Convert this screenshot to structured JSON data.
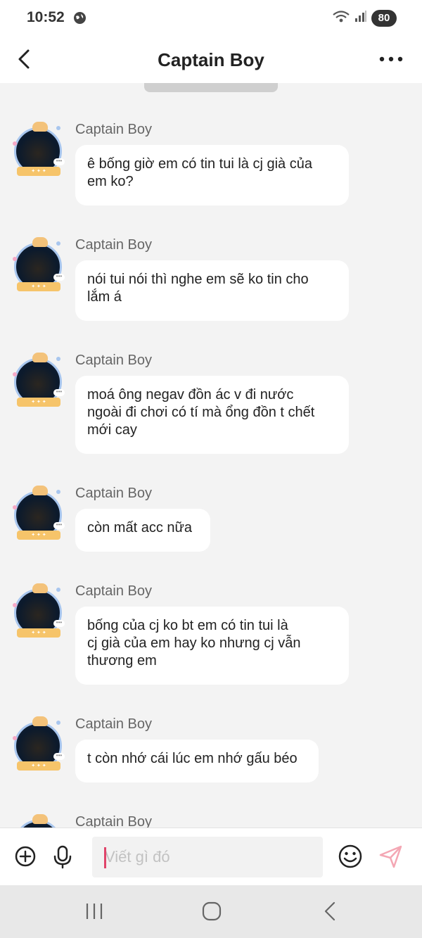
{
  "status_bar": {
    "time": "10:52",
    "battery": "80",
    "icons": [
      "globe-icon",
      "wifi-icon",
      "signal-icon",
      "battery-icon"
    ]
  },
  "header": {
    "title": "Captain Boy",
    "icons": [
      "back-arrow-icon",
      "more-dots-icon"
    ]
  },
  "messages": [
    {
      "sender": "Captain Boy",
      "text": "ê bống giờ em có tin tui là cj già của\nem ko?"
    },
    {
      "sender": "Captain Boy",
      "text": "nói tui nói thì nghe em sẽ ko tin cho\nlắm á"
    },
    {
      "sender": "Captain Boy",
      "text": "moá ông negav đồn ác v đi nước\nngoài đi chơi có tí mà ổng đồn t chết\nmới cay"
    },
    {
      "sender": "Captain Boy",
      "text": "còn mất acc nữa"
    },
    {
      "sender": "Captain Boy",
      "text": "bống của cj ko bt em có tin tui là\ncj già của em hay ko nhưng cj vẫn\nthương em"
    },
    {
      "sender": "Captain Boy",
      "text": "t còn nhớ cái lúc em nhớ gấu béo"
    },
    {
      "sender": "Captain Boy",
      "text": ""
    }
  ],
  "input_bar": {
    "placeholder": "Viết gì đó",
    "value": "",
    "icons": [
      "plus-circle-icon",
      "microphone-icon",
      "emoji-icon",
      "send-icon"
    ],
    "send_color": "#f4a7b4"
  },
  "nav_bar": {
    "icons": [
      "recent-apps-icon",
      "home-icon",
      "back-icon"
    ]
  },
  "colors": {
    "background": "#f3f3f3",
    "bubble": "#ffffff",
    "caret": "#e0446a"
  }
}
